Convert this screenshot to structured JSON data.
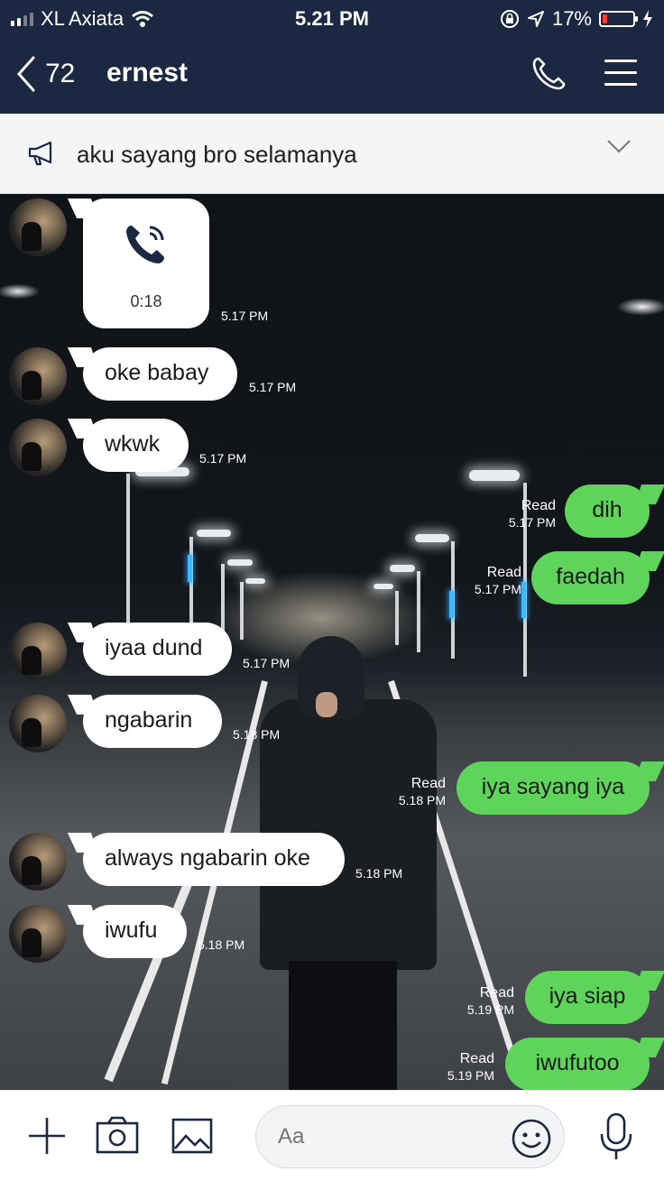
{
  "status_bar": {
    "carrier": "XL Axiata",
    "time": "5.21 PM",
    "battery": "17%",
    "battery_fraction": 0.17
  },
  "header": {
    "back_count": "72",
    "title": "ernest",
    "icons": [
      "chevron-left-icon",
      "phone-icon",
      "menu-icon"
    ]
  },
  "announcement": {
    "text": "aku sayang bro selamanya",
    "icons": [
      "megaphone-icon",
      "chevron-down-icon"
    ]
  },
  "call": {
    "duration": "0:18",
    "time": "5.17 PM"
  },
  "messages": [
    {
      "dir": "in",
      "text": "oke babay",
      "time": "5.17 PM"
    },
    {
      "dir": "in",
      "text": "wkwk",
      "time": "5.17 PM"
    },
    {
      "dir": "out",
      "text": "dih",
      "read": "Read",
      "time": "5.17 PM"
    },
    {
      "dir": "out",
      "text": "faedah",
      "read": "Read",
      "time": "5.17 PM"
    },
    {
      "dir": "in",
      "text": "iyaa dund",
      "time": "5.17 PM"
    },
    {
      "dir": "in",
      "text": "ngabarin",
      "time": "5.18 PM"
    },
    {
      "dir": "out",
      "text": "iya sayang iya",
      "read": "Read",
      "time": "5.18 PM"
    },
    {
      "dir": "in",
      "text": "always ngabarin oke",
      "time": "5.18 PM"
    },
    {
      "dir": "in",
      "text": "iwufu",
      "time": "5.18 PM"
    },
    {
      "dir": "out",
      "text": "iya siap",
      "read": "Read",
      "time": "5.19 PM"
    },
    {
      "dir": "out",
      "text": "iwufutoo",
      "read": "Read",
      "time": "5.19 PM"
    }
  ],
  "composer": {
    "placeholder": "Aa",
    "icons": [
      "plus-icon",
      "camera-icon",
      "image-icon",
      "emoji-icon",
      "microphone-icon"
    ]
  },
  "colors": {
    "header_bg": "#1c2742",
    "outgoing_bubble": "#5ed45a",
    "incoming_bubble": "#ffffff",
    "battery_low": "#ff3b30"
  }
}
